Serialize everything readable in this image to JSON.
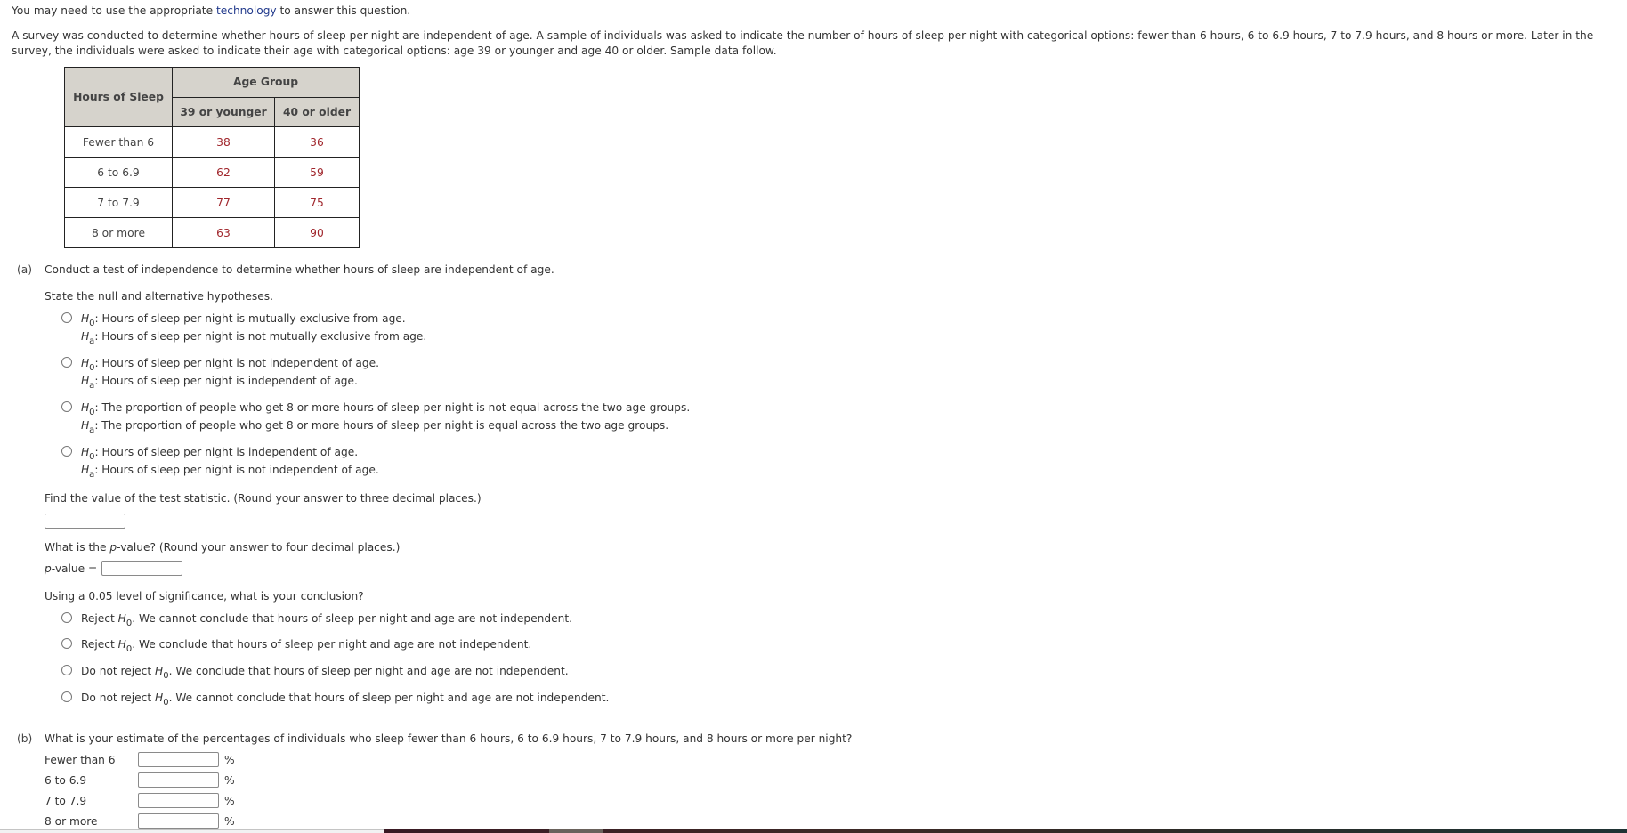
{
  "intro": {
    "prefix": "You may need to use the appropriate ",
    "link": "technology",
    "suffix": " to answer this question."
  },
  "problem_text": "A survey was conducted to determine whether hours of sleep per night are independent of age. A sample of individuals was asked to indicate the number of hours of sleep per night with categorical options: fewer than 6 hours, 6 to 6.9 hours, 7 to 7.9 hours, and 8 hours or more. Later in the survey, the individuals were asked to indicate their age with categorical options: age 39 or younger and age 40 or older. Sample data follow.",
  "table": {
    "row_header": "Hours of Sleep",
    "group_header": "Age Group",
    "columns": [
      "39 or younger",
      "40 or older"
    ],
    "rows": [
      {
        "label": "Fewer than 6",
        "values": [
          "38",
          "36"
        ]
      },
      {
        "label": "6 to 6.9",
        "values": [
          "62",
          "59"
        ]
      },
      {
        "label": "7 to 7.9",
        "values": [
          "77",
          "75"
        ]
      },
      {
        "label": "8 or more",
        "values": [
          "63",
          "90"
        ]
      }
    ]
  },
  "part_a": {
    "letter": "(a)",
    "question": "Conduct a test of independence to determine whether hours of sleep are independent of age.",
    "hypotheses_prompt": "State the null and alternative hypotheses.",
    "h_symbol": "H",
    "h0_sub": "0",
    "ha_sub": "a",
    "hypothesis_options": [
      {
        "h0": ": Hours of sleep per night is mutually exclusive from age.",
        "ha": ": Hours of sleep per night is not mutually exclusive from age."
      },
      {
        "h0": ": Hours of sleep per night is not independent of age.",
        "ha": ": Hours of sleep per night is independent of age."
      },
      {
        "h0": ": The proportion of people who get 8 or more hours of sleep per night is not equal across the two age groups.",
        "ha": ": The proportion of people who get 8 or more hours of sleep per night is equal across the two age groups."
      },
      {
        "h0": ": Hours of sleep per night is independent of age.",
        "ha": ": Hours of sleep per night is not independent of age."
      }
    ],
    "test_stat_prompt": "Find the value of the test statistic. (Round your answer to three decimal places.)",
    "test_stat_value": "",
    "pvalue_prompt_prefix": "What is the ",
    "pvalue_p": "p",
    "pvalue_prompt_suffix": "-value? (Round your answer to four decimal places.)",
    "pvalue_label_suffix": "-value =",
    "pvalue_value": "",
    "conclusion_prompt": "Using a 0.05 level of significance, what is your conclusion?",
    "conclusion_options": [
      {
        "prefix": "Reject ",
        "suffix": ". We cannot conclude that hours of sleep per night and age are not independent."
      },
      {
        "prefix": "Reject ",
        "suffix": ". We conclude that hours of sleep per night and age are not independent."
      },
      {
        "prefix": "Do not reject ",
        "suffix": ". We conclude that hours of sleep per night and age are not independent."
      },
      {
        "prefix": "Do not reject ",
        "suffix": ". We cannot conclude that hours of sleep per night and age are not independent."
      }
    ]
  },
  "part_b": {
    "letter": "(b)",
    "question": "What is your estimate of the percentages of individuals who sleep fewer than 6 hours, 6 to 6.9 hours, 7 to 7.9 hours, and 8 hours or more per night?",
    "percent_symbol": "%",
    "rows": [
      {
        "label": "Fewer than 6",
        "value": ""
      },
      {
        "label": "6 to 6.9",
        "value": ""
      },
      {
        "label": "7 to 7.9",
        "value": ""
      },
      {
        "label": "8 or more",
        "value": ""
      }
    ]
  },
  "colors": {
    "table_header_bg": "#d6d3cc",
    "data_value": "#a0262c",
    "link": "#223a8c",
    "text": "#333333"
  }
}
